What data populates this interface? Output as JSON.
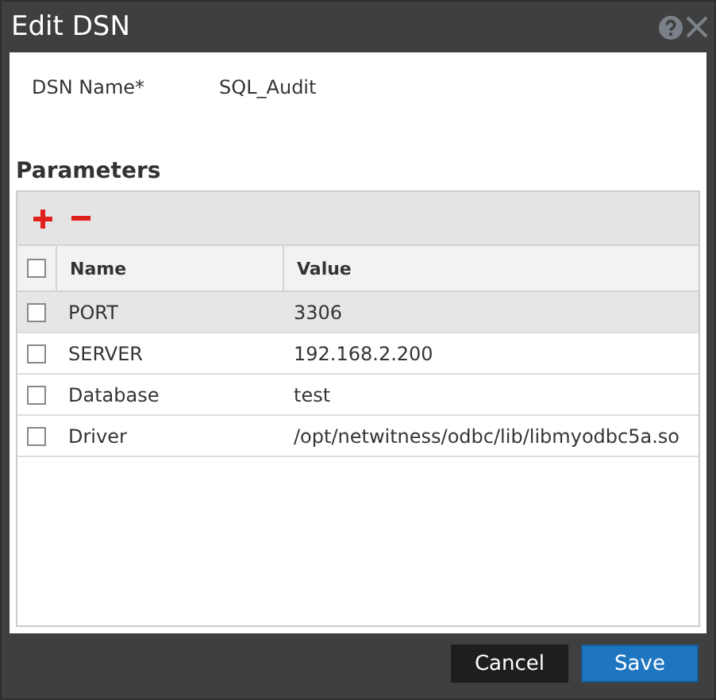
{
  "window": {
    "title": "Edit DSN"
  },
  "dsn_name": {
    "label": "DSN Name*",
    "value": "SQL_Audit"
  },
  "parameters": {
    "title": "Parameters",
    "columns": [
      "Name",
      "Value"
    ],
    "header_checked": false,
    "rows": [
      {
        "name": "PORT",
        "value": "3306",
        "checked": false,
        "selected": true
      },
      {
        "name": "SERVER",
        "value": "192.168.2.200",
        "checked": false,
        "selected": false
      },
      {
        "name": "Database",
        "value": "test",
        "checked": false,
        "selected": false
      },
      {
        "name": "Driver",
        "value": "/opt/netwitness/odbc/lib/libmyodbc5a.so",
        "checked": false,
        "selected": false
      }
    ]
  },
  "buttons": [
    {
      "label": "Cancel",
      "kind": "secondary"
    },
    {
      "label": "Save",
      "kind": "primary"
    }
  ]
}
